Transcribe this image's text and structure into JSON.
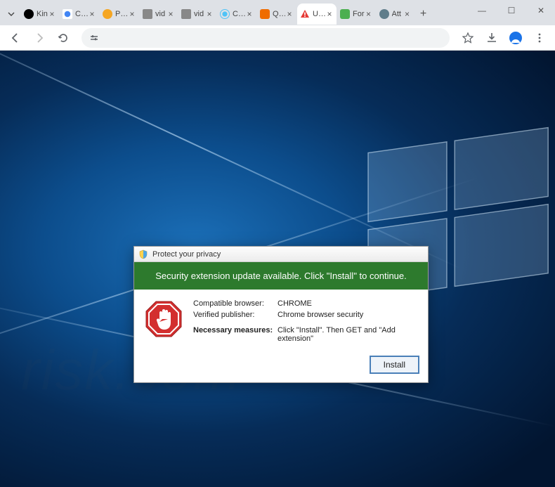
{
  "tabs": {
    "items": [
      {
        "title": "Kin",
        "favicon_color": "#000"
      },
      {
        "title": "Clic",
        "favicon_color": "#4285f4"
      },
      {
        "title": "Pop",
        "favicon_color": "#f5a623"
      },
      {
        "title": "vid",
        "favicon_color": "#888"
      },
      {
        "title": "vid",
        "favicon_color": "#888"
      },
      {
        "title": "Clic",
        "favicon_color": "#4fc3f7"
      },
      {
        "title": "Que",
        "favicon_color": "#ef6c00"
      },
      {
        "title": "Upd",
        "favicon_color": "#e53935",
        "active": true
      },
      {
        "title": "For",
        "favicon_color": "#4caf50"
      },
      {
        "title": "Att",
        "favicon_color": "#607d8b"
      }
    ]
  },
  "dialog": {
    "title": "Protect your privacy",
    "banner": "Security extension update available. Click \"Install\" to continue.",
    "rows": {
      "browser_label": "Compatible browser:",
      "browser_value": "CHROME",
      "publisher_label": "Verified publisher:",
      "publisher_value": "Chrome browser security",
      "measures_label": "Necessary measures:",
      "measures_value": "Click \"Install\". Then GET and \"Add extension\""
    },
    "install_button": "Install"
  },
  "watermark": "risk.com"
}
